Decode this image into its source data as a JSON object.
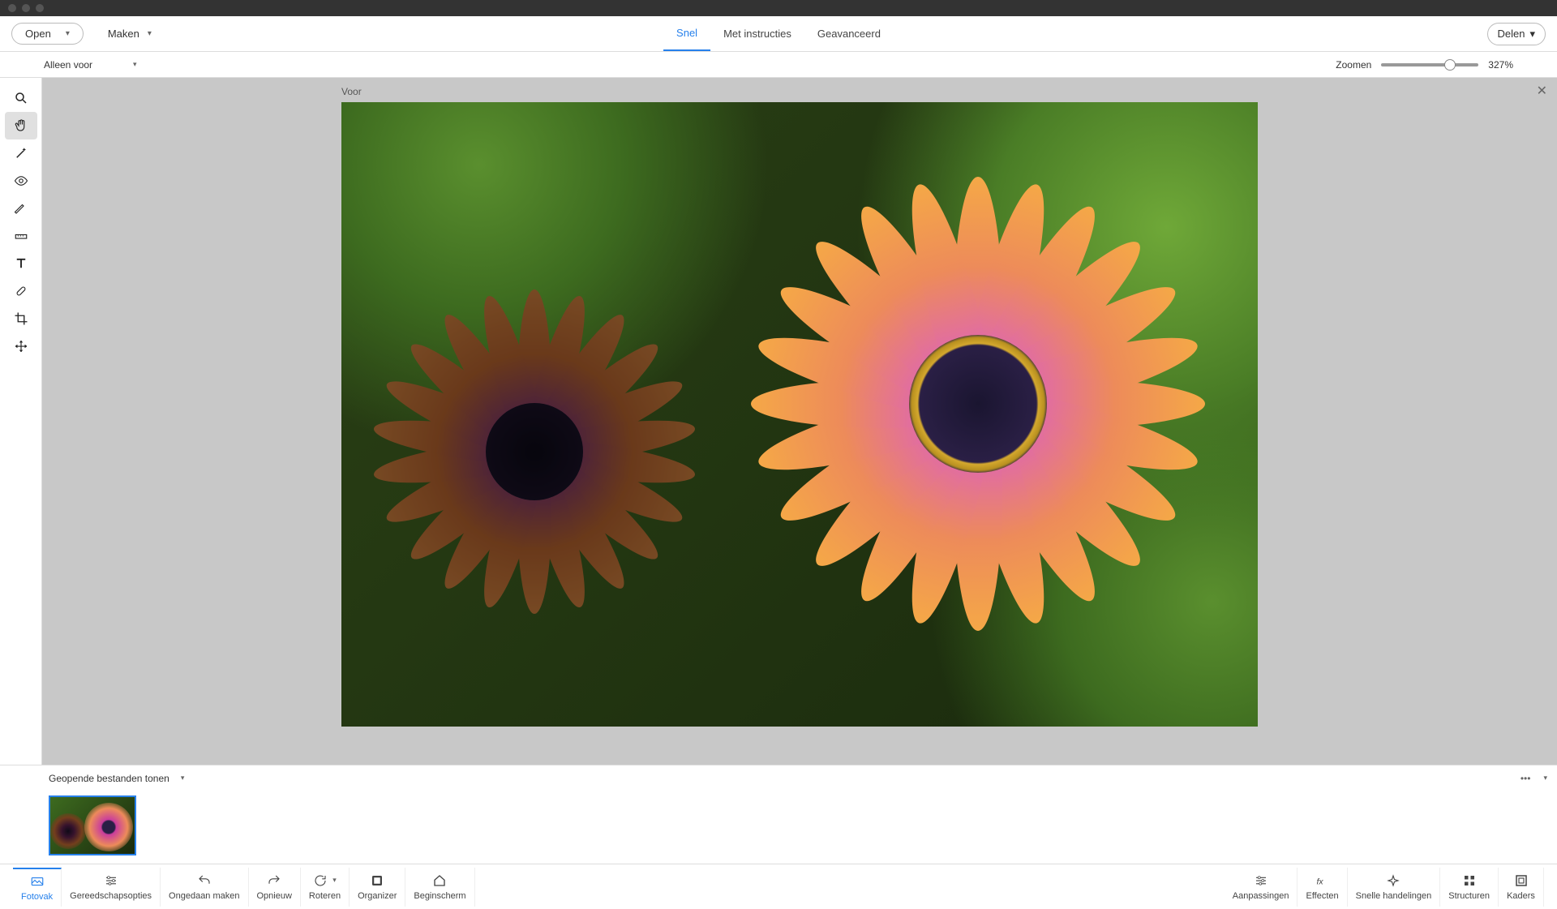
{
  "topbar": {
    "open_label": "Open",
    "maken_label": "Maken",
    "share_label": "Delen",
    "tabs": {
      "snel": "Snel",
      "met_instructies": "Met instructies",
      "geavanceerd": "Geavanceerd"
    }
  },
  "optionsbar": {
    "view_label": "Alleen voor",
    "zoom_label": "Zoomen",
    "zoom_value": "327%"
  },
  "canvas": {
    "label": "Voor"
  },
  "photobin": {
    "header_label": "Geopende bestanden tonen"
  },
  "bottombar": {
    "fotovak": "Fotovak",
    "gereedschapsopties": "Gereedschapsopties",
    "ongedaan": "Ongedaan maken",
    "opnieuw": "Opnieuw",
    "roteren": "Roteren",
    "organizer": "Organizer",
    "beginscherm": "Beginscherm",
    "aanpassingen": "Aanpassingen",
    "effecten": "Effecten",
    "snelle": "Snelle handelingen",
    "structuren": "Structuren",
    "kaders": "Kaders"
  }
}
